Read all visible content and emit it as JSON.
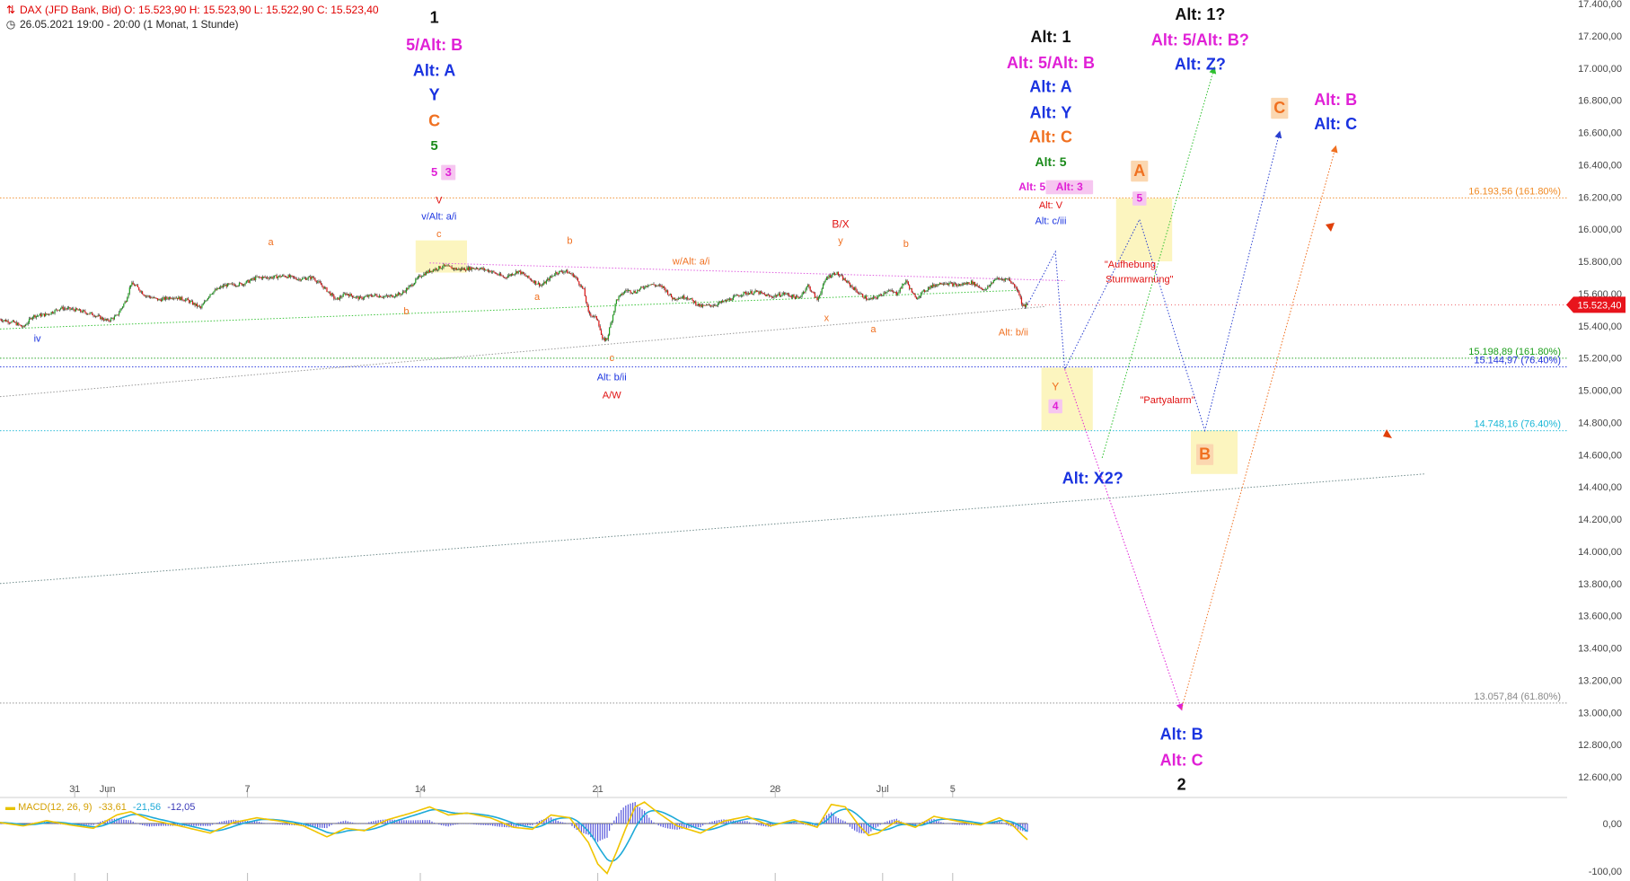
{
  "header": {
    "line1": "DAX (JFD Bank, Bid)  O: 15.523,90  H: 15.523,90  L: 15.522,90  C: 15.523,40",
    "line2": "26.05.2021 19:00 - 20:00  (1 Monat, 1 Stunde)"
  },
  "icons": {
    "header_icon": "chart-icon",
    "time_icon": "clock-icon"
  },
  "colors": {
    "price_up": "#1a9e1a",
    "price_down": "#d11",
    "last_price_bg": "#e8141c",
    "highlight_box": "#fbf3b4"
  },
  "chart_data": {
    "type": "line",
    "title": "DAX (JFD Bank, Bid)",
    "interval": "1 Stunde",
    "range": "1 Monat",
    "ohlc_last": {
      "open": 15523.9,
      "high": 15523.9,
      "low": 15522.9,
      "close": 15523.4
    },
    "y_axis": {
      "min": 12500,
      "max": 17400,
      "ticks": [
        "12.600,00",
        "12.800,00",
        "13.000,00",
        "13.200,00",
        "13.400,00",
        "13.600,00",
        "13.800,00",
        "14.000,00",
        "14.200,00",
        "14.400,00",
        "14.600,00",
        "14.800,00",
        "15.000,00",
        "15.200,00",
        "15.400,00",
        "15.600,00",
        "15.800,00",
        "16.000,00",
        "16.200,00",
        "16.400,00",
        "16.600,00",
        "16.800,00",
        "17.000,00",
        "17.200,00",
        "17.400,00"
      ]
    },
    "x_axis": {
      "ticks": [
        {
          "label": "31",
          "i": 16
        },
        {
          "label": "Jun",
          "i": 23
        },
        {
          "label": "7",
          "i": 53
        },
        {
          "label": "14",
          "i": 90
        },
        {
          "label": "21",
          "i": 128
        },
        {
          "label": "28",
          "i": 166
        },
        {
          "label": "Jul",
          "i": 189
        },
        {
          "label": "5",
          "i": 204
        }
      ]
    },
    "last_price_label": "15.523,40",
    "price_anchors": [
      [
        0,
        15440
      ],
      [
        3,
        15420
      ],
      [
        5,
        15390
      ],
      [
        7,
        15460
      ],
      [
        10,
        15470
      ],
      [
        13,
        15510
      ],
      [
        16,
        15500
      ],
      [
        20,
        15470
      ],
      [
        23,
        15430
      ],
      [
        25,
        15460
      ],
      [
        27,
        15560
      ],
      [
        28,
        15660
      ],
      [
        29,
        15650
      ],
      [
        31,
        15590
      ],
      [
        34,
        15560
      ],
      [
        37,
        15580
      ],
      [
        40,
        15560
      ],
      [
        43,
        15510
      ],
      [
        45,
        15600
      ],
      [
        48,
        15650
      ],
      [
        52,
        15660
      ],
      [
        55,
        15700
      ],
      [
        58,
        15700
      ],
      [
        61,
        15710
      ],
      [
        64,
        15690
      ],
      [
        67,
        15700
      ],
      [
        70,
        15620
      ],
      [
        72,
        15560
      ],
      [
        74,
        15600
      ],
      [
        77,
        15570
      ],
      [
        80,
        15590
      ],
      [
        83,
        15580
      ],
      [
        86,
        15600
      ],
      [
        88,
        15650
      ],
      [
        90,
        15710
      ],
      [
        92,
        15740
      ],
      [
        95,
        15770
      ],
      [
        98,
        15750
      ],
      [
        102,
        15760
      ],
      [
        105,
        15740
      ],
      [
        108,
        15700
      ],
      [
        111,
        15740
      ],
      [
        114,
        15680
      ],
      [
        116,
        15650
      ],
      [
        119,
        15730
      ],
      [
        121,
        15740
      ],
      [
        123,
        15710
      ],
      [
        125,
        15620
      ],
      [
        126,
        15480
      ],
      [
        128,
        15440
      ],
      [
        129,
        15310
      ],
      [
        130,
        15320
      ],
      [
        131,
        15440
      ],
      [
        132,
        15560
      ],
      [
        134,
        15620
      ],
      [
        136,
        15610
      ],
      [
        139,
        15660
      ],
      [
        142,
        15640
      ],
      [
        144,
        15570
      ],
      [
        147,
        15580
      ],
      [
        150,
        15520
      ],
      [
        153,
        15530
      ],
      [
        156,
        15560
      ],
      [
        159,
        15600
      ],
      [
        162,
        15610
      ],
      [
        165,
        15580
      ],
      [
        168,
        15600
      ],
      [
        171,
        15570
      ],
      [
        173,
        15650
      ],
      [
        175,
        15560
      ],
      [
        177,
        15700
      ],
      [
        179,
        15730
      ],
      [
        181,
        15680
      ],
      [
        184,
        15600
      ],
      [
        186,
        15560
      ],
      [
        188,
        15580
      ],
      [
        190,
        15620
      ],
      [
        192,
        15600
      ],
      [
        194,
        15680
      ],
      [
        196,
        15570
      ],
      [
        199,
        15640
      ],
      [
        202,
        15670
      ],
      [
        205,
        15650
      ],
      [
        208,
        15670
      ],
      [
        211,
        15620
      ],
      [
        213,
        15690
      ],
      [
        216,
        15690
      ],
      [
        218,
        15620
      ],
      [
        219,
        15520
      ],
      [
        220,
        15530
      ]
    ],
    "macd": {
      "legend": "MACD(12, 26, 9)",
      "macd_value": "-33,61",
      "signal_value": "-21,56",
      "hist_value": "-12,05",
      "y_ticks": [
        "0,00",
        "-100,00"
      ],
      "anchors": [
        [
          0,
          2
        ],
        [
          5,
          -5
        ],
        [
          10,
          6
        ],
        [
          15,
          -3
        ],
        [
          20,
          -10
        ],
        [
          25,
          18
        ],
        [
          28,
          25
        ],
        [
          32,
          8
        ],
        [
          38,
          -4
        ],
        [
          45,
          -20
        ],
        [
          50,
          2
        ],
        [
          55,
          12
        ],
        [
          60,
          5
        ],
        [
          65,
          -5
        ],
        [
          70,
          -28
        ],
        [
          74,
          -10
        ],
        [
          78,
          -15
        ],
        [
          83,
          8
        ],
        [
          88,
          22
        ],
        [
          92,
          35
        ],
        [
          96,
          18
        ],
        [
          100,
          22
        ],
        [
          105,
          12
        ],
        [
          110,
          -8
        ],
        [
          114,
          -12
        ],
        [
          118,
          18
        ],
        [
          122,
          12
        ],
        [
          126,
          -40
        ],
        [
          128,
          -85
        ],
        [
          130,
          -105
        ],
        [
          132,
          -60
        ],
        [
          134,
          -10
        ],
        [
          136,
          35
        ],
        [
          138,
          45
        ],
        [
          141,
          22
        ],
        [
          145,
          -5
        ],
        [
          150,
          -20
        ],
        [
          155,
          5
        ],
        [
          160,
          15
        ],
        [
          165,
          -5
        ],
        [
          170,
          8
        ],
        [
          175,
          -8
        ],
        [
          178,
          40
        ],
        [
          181,
          35
        ],
        [
          184,
          -5
        ],
        [
          186,
          -25
        ],
        [
          188,
          -20
        ],
        [
          192,
          5
        ],
        [
          196,
          -8
        ],
        [
          200,
          15
        ],
        [
          205,
          5
        ],
        [
          210,
          -3
        ],
        [
          214,
          12
        ],
        [
          217,
          -5
        ],
        [
          219,
          -25
        ],
        [
          220,
          -34
        ]
      ]
    },
    "fib_levels": [
      {
        "label": "16.193,56 (161.80%)",
        "value": 16193.56,
        "color": "#f08a24"
      },
      {
        "label": "15.198,89 (161.80%)",
        "value": 15198.89,
        "color": "#1a9e1a"
      },
      {
        "label": "15.144,97 (76.40%)",
        "value": 15144.97,
        "color": "#2233dd"
      },
      {
        "label": "14.748,16 (76.40%)",
        "value": 14748.16,
        "color": "#19b7d6"
      },
      {
        "label": "13.057,84 (61.80%)",
        "value": 13057.84,
        "color": "#888888"
      }
    ],
    "wave_labels": [
      {
        "text": "1",
        "i": 93,
        "v": 17280,
        "color": "#111111",
        "size": 18,
        "bold": true
      },
      {
        "text": "5/Alt: B",
        "i": 93,
        "v": 17110,
        "color": "#e020d6",
        "size": 18,
        "bold": true
      },
      {
        "text": "Alt: A",
        "i": 93,
        "v": 16950,
        "color": "#1a33e0",
        "size": 18,
        "bold": true
      },
      {
        "text": "Y",
        "i": 93,
        "v": 16800,
        "color": "#1a33e0",
        "size": 18,
        "bold": true
      },
      {
        "text": "C",
        "i": 93,
        "v": 16640,
        "color": "#f07020",
        "size": 18,
        "bold": true
      },
      {
        "text": "5",
        "i": 93,
        "v": 16490,
        "color": "#1a8a1a",
        "size": 15,
        "bold": true
      },
      {
        "text": "5",
        "i": 93,
        "v": 16330,
        "color": "#e020d6",
        "size": 13,
        "bold": true
      },
      {
        "text": "3",
        "i": 96,
        "v": 16330,
        "color": "#e020d6",
        "size": 13,
        "bold": true,
        "box": "#f6c6f0"
      },
      {
        "text": "V",
        "i": 94,
        "v": 16160,
        "color": "#e01010",
        "size": 11
      },
      {
        "text": "v/Alt: a/i",
        "i": 94,
        "v": 16060,
        "color": "#1a33e0",
        "size": 11
      },
      {
        "text": "c",
        "i": 94,
        "v": 15950,
        "color": "#f07020",
        "size": 11
      },
      {
        "text": "a",
        "i": 58,
        "v": 15900,
        "color": "#f07020",
        "size": 11
      },
      {
        "text": "b",
        "i": 122,
        "v": 15910,
        "color": "#f07020",
        "size": 11
      },
      {
        "text": "b",
        "i": 87,
        "v": 15470,
        "color": "#f07020",
        "size": 11
      },
      {
        "text": "iv",
        "i": 8,
        "v": 15300,
        "color": "#1a33e0",
        "size": 11
      },
      {
        "text": "a",
        "i": 115,
        "v": 15560,
        "color": "#f07020",
        "size": 11
      },
      {
        "text": "w/Alt: a/i",
        "i": 148,
        "v": 15780,
        "color": "#f07020",
        "size": 11
      },
      {
        "text": "c",
        "i": 131,
        "v": 15180,
        "color": "#f07020",
        "size": 11
      },
      {
        "text": "Alt: b/ii",
        "i": 131,
        "v": 15060,
        "color": "#1a33e0",
        "size": 11
      },
      {
        "text": "A/W",
        "i": 131,
        "v": 14950,
        "color": "#e01010",
        "size": 11
      },
      {
        "text": "B/X",
        "i": 180,
        "v": 16010,
        "color": "#e01010",
        "size": 12
      },
      {
        "text": "y",
        "i": 180,
        "v": 15910,
        "color": "#f07020",
        "size": 11
      },
      {
        "text": "b",
        "i": 194,
        "v": 15890,
        "color": "#f07020",
        "size": 11
      },
      {
        "text": "x",
        "i": 177,
        "v": 15430,
        "color": "#f07020",
        "size": 11
      },
      {
        "text": "a",
        "i": 187,
        "v": 15360,
        "color": "#f07020",
        "size": 11
      },
      {
        "text": "Alt: 1",
        "i": 225,
        "v": 17160,
        "color": "#111111",
        "size": 18,
        "bold": true
      },
      {
        "text": "Alt: 5/Alt: B",
        "i": 225,
        "v": 17000,
        "color": "#e020d6",
        "size": 18,
        "bold": true
      },
      {
        "text": "Alt: A",
        "i": 225,
        "v": 16850,
        "color": "#1a33e0",
        "size": 18,
        "bold": true
      },
      {
        "text": "Alt: Y",
        "i": 225,
        "v": 16690,
        "color": "#1a33e0",
        "size": 18,
        "bold": true
      },
      {
        "text": "Alt: C",
        "i": 225,
        "v": 16540,
        "color": "#f07020",
        "size": 18,
        "bold": true
      },
      {
        "text": "Alt: 5",
        "i": 225,
        "v": 16390,
        "color": "#1a8a1a",
        "size": 14,
        "bold": true
      },
      {
        "text": "Alt: 5",
        "i": 221,
        "v": 16240,
        "color": "#e020d6",
        "size": 12,
        "bold": true
      },
      {
        "text": "Alt: 3",
        "i": 229,
        "v": 16240,
        "color": "#e020d6",
        "size": 12,
        "bold": true,
        "box": "#f6c6f0"
      },
      {
        "text": "Alt: V",
        "i": 225,
        "v": 16130,
        "color": "#e01010",
        "size": 11
      },
      {
        "text": "Alt: c/iii",
        "i": 225,
        "v": 16030,
        "color": "#1a33e0",
        "size": 11
      },
      {
        "text": "Alt: b/ii",
        "i": 217,
        "v": 15340,
        "color": "#f07020",
        "size": 11
      },
      {
        "text": "Y",
        "i": 226,
        "v": 15000,
        "color": "#f07020",
        "size": 12
      },
      {
        "text": "4",
        "i": 226,
        "v": 14880,
        "color": "#e020d6",
        "size": 12,
        "bold": true,
        "box": "#f6c6f0"
      },
      {
        "text": "Alt: X2?",
        "i": 234,
        "v": 14420,
        "color": "#1a33e0",
        "size": 18,
        "bold": true
      },
      {
        "text": "A",
        "i": 244,
        "v": 16330,
        "color": "#f07020",
        "size": 18,
        "bold": true,
        "box": "#fbd7b0"
      },
      {
        "text": "5",
        "i": 244,
        "v": 16170,
        "color": "#e020d6",
        "size": 12,
        "bold": true,
        "box": "#f6c6f0"
      },
      {
        "text": "\"Aufhebung",
        "i": 242,
        "v": 15760,
        "color": "#e01010",
        "size": 11
      },
      {
        "text": "Sturmwarnung\"",
        "i": 244,
        "v": 15670,
        "color": "#e01010",
        "size": 11
      },
      {
        "text": "\"Partyalarm\"",
        "i": 250,
        "v": 14920,
        "color": "#e01010",
        "size": 11
      },
      {
        "text": "B",
        "i": 258,
        "v": 14570,
        "color": "#f07020",
        "size": 18,
        "bold": true,
        "box": "#fbd7b0"
      },
      {
        "text": "Alt: 1?",
        "i": 257,
        "v": 17300,
        "color": "#111111",
        "size": 18,
        "bold": true
      },
      {
        "text": "Alt: 5/Alt: B?",
        "i": 257,
        "v": 17140,
        "color": "#e020d6",
        "size": 18,
        "bold": true
      },
      {
        "text": "Alt: Z?",
        "i": 257,
        "v": 16990,
        "color": "#1a33e0",
        "size": 18,
        "bold": true
      },
      {
        "text": "C",
        "i": 274,
        "v": 16720,
        "color": "#f07020",
        "size": 18,
        "bold": true,
        "box": "#fbd7b0"
      },
      {
        "text": "Alt: B",
        "i": 286,
        "v": 16770,
        "color": "#e020d6",
        "size": 18,
        "bold": true
      },
      {
        "text": "Alt: C",
        "i": 286,
        "v": 16620,
        "color": "#1a33e0",
        "size": 18,
        "bold": true
      },
      {
        "text": "Alt: B",
        "i": 253,
        "v": 12830,
        "color": "#1a33e0",
        "size": 18,
        "bold": true
      },
      {
        "text": "Alt: C",
        "i": 253,
        "v": 12670,
        "color": "#e020d6",
        "size": 18,
        "bold": true
      },
      {
        "text": "2",
        "i": 253,
        "v": 12520,
        "color": "#111111",
        "size": 18,
        "bold": true
      }
    ],
    "projection_paths": [
      {
        "name": "blue-dotted",
        "color": "#2a3fd0",
        "points": [
          [
            220,
            15530
          ],
          [
            226,
            15860
          ],
          [
            228,
            15130
          ],
          [
            244,
            16060
          ],
          [
            258,
            14750
          ],
          [
            274,
            16600
          ]
        ]
      },
      {
        "name": "green-dotted",
        "color": "#2ec02e",
        "points": [
          [
            236,
            14580
          ],
          [
            260,
            17000
          ]
        ]
      },
      {
        "name": "magenta-dotted",
        "color": "#e020d6",
        "points": [
          [
            228,
            15130
          ],
          [
            253,
            13020
          ]
        ]
      },
      {
        "name": "orange-dotted",
        "color": "#f07020",
        "points": [
          [
            253,
            13020
          ],
          [
            286,
            16510
          ]
        ]
      }
    ],
    "trendlines": [
      {
        "color": "#3cc43c",
        "points": [
          [
            0,
            15380
          ],
          [
            218,
            15620
          ]
        ]
      },
      {
        "color": "#e060e0",
        "points": [
          [
            92,
            15790
          ],
          [
            228,
            15680
          ]
        ]
      },
      {
        "color": "#999999",
        "points": [
          [
            0,
            14960
          ],
          [
            224,
            15520
          ]
        ]
      },
      {
        "color": "#708c8c",
        "points": [
          [
            0,
            13800
          ],
          [
            305,
            14480
          ]
        ]
      }
    ],
    "highlight_boxes": [
      {
        "i0": 89,
        "i1": 100,
        "v0": 15730,
        "v1": 15930
      },
      {
        "i0": 223,
        "i1": 234,
        "v0": 14750,
        "v1": 15140
      },
      {
        "i0": 239,
        "i1": 251,
        "v0": 15800,
        "v1": 16190
      },
      {
        "i0": 255,
        "i1": 265,
        "v0": 14480,
        "v1": 14750
      }
    ]
  }
}
